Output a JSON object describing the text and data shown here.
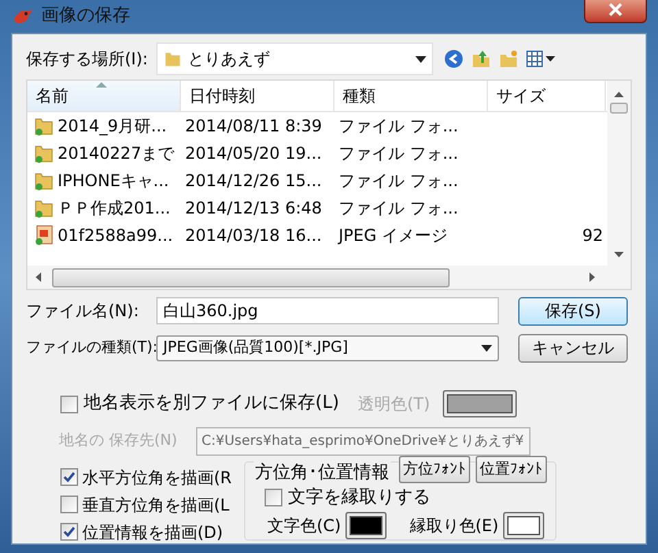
{
  "window": {
    "title": "画像の保存"
  },
  "location": {
    "label": "保存する場所(I):",
    "value": "とりあえず"
  },
  "file_list": {
    "columns": [
      {
        "label": "名前",
        "sorted": true
      },
      {
        "label": "日付時刻",
        "sorted": false
      },
      {
        "label": "種類",
        "sorted": false
      },
      {
        "label": "サイズ",
        "sorted": false
      }
    ],
    "rows": [
      {
        "kind": "folder",
        "name": "2014_9月研...",
        "date": "2014/08/11 8:39",
        "type": "ファイル フォ...",
        "size": ""
      },
      {
        "kind": "folder",
        "name": "20140227まで",
        "date": "2014/05/20 19...",
        "type": "ファイル フォ...",
        "size": ""
      },
      {
        "kind": "folder",
        "name": "IPHONEキャ...",
        "date": "2014/12/26 15...",
        "type": "ファイル フォ...",
        "size": ""
      },
      {
        "kind": "folder",
        "name": "ＰＰ作成201...",
        "date": "2014/12/13 6:48",
        "type": "ファイル フォ...",
        "size": ""
      },
      {
        "kind": "image",
        "name": "01f2588a99...",
        "date": "2014/03/18 16...",
        "type": "JPEG イメージ",
        "size": "92"
      }
    ]
  },
  "file_name": {
    "label": "ファイル名(N):",
    "value": "白山360.jpg"
  },
  "file_type": {
    "label": "ファイルの種類(T):",
    "value": "JPEG画像(品質100)[*.JPG]"
  },
  "buttons": {
    "save": "保存(S)",
    "cancel": "キャンセル"
  },
  "separate_file": {
    "label": "地名表示を別ファイルに保存(L)",
    "checked": false
  },
  "transparent_color": {
    "label": "透明色(T)",
    "disabled": true,
    "color": "#a0a0a0"
  },
  "save_destination": {
    "label": "地名の 保存先(N)",
    "value": "C:¥Users¥hata_esprimo¥OneDrive¥とりあえず¥",
    "disabled": true
  },
  "draw_options": [
    {
      "label": "水平方位角を描画(R",
      "checked": true
    },
    {
      "label": "垂直方位角を描画(L",
      "checked": false
    },
    {
      "label": "位置情報を描画(D)",
      "checked": true
    }
  ],
  "group": {
    "title": "方位角･位置情報",
    "outline": {
      "label": "文字を縁取りする",
      "checked": false
    },
    "font_buttons": [
      "方位ﾌｫﾝﾄ",
      "位置ﾌｫﾝﾄ"
    ],
    "text_color": {
      "label": "文字色(C)",
      "color": "#000000"
    },
    "outline_color": {
      "label": "縁取り色(E)",
      "color": "#ffffff"
    }
  }
}
